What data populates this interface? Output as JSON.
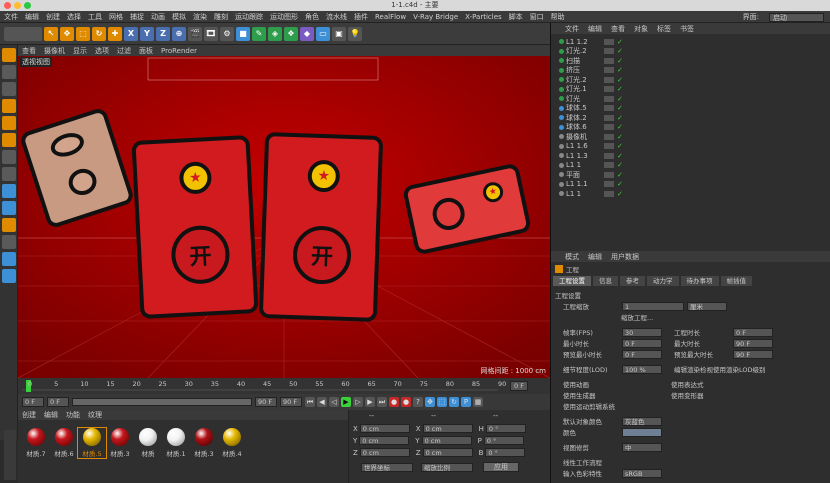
{
  "window": {
    "title": "1-1.c4d - 主要"
  },
  "menubar": [
    "文件",
    "编辑",
    "创建",
    "选择",
    "工具",
    "网格",
    "捕捉",
    "动画",
    "模拟",
    "渲染",
    "雕刻",
    "运动跟踪",
    "运动图形",
    "角色",
    "流水线",
    "插件",
    "RealFlow",
    "V-Ray Bridge",
    "X-Particles",
    "脚本",
    "窗口",
    "帮助"
  ],
  "layout": {
    "label": "界面:",
    "value": "启动"
  },
  "toolbar": {
    "axis_x": "X",
    "axis_y": "Y",
    "axis_z": "Z"
  },
  "viewport": {
    "menu": [
      "查看",
      "摄像机",
      "显示",
      "选项",
      "过滤",
      "面板",
      "ProRender"
    ],
    "label": "透视视图",
    "grid_info": "网格间距 : 1000 cm",
    "glyph": "开"
  },
  "timeline": {
    "ticks": [
      "0",
      "5",
      "10",
      "15",
      "20",
      "25",
      "30",
      "35",
      "40",
      "45",
      "50",
      "55",
      "60",
      "65",
      "70",
      "75",
      "80",
      "85",
      "90"
    ],
    "end": "0 F"
  },
  "transport": {
    "start": "0 F",
    "current": "0 F",
    "end": "90 F",
    "end2": "90 F"
  },
  "materials": {
    "menu": [
      "创建",
      "编辑",
      "功能",
      "纹理"
    ],
    "items": [
      {
        "label": "材质.7",
        "color": "#c4161c"
      },
      {
        "label": "材质.6",
        "color": "#c4161c"
      },
      {
        "label": "材质.5",
        "color": "#e6b800"
      },
      {
        "label": "材质.3",
        "color": "#c4161c"
      },
      {
        "label": "材质",
        "color": "#f2f2f2"
      },
      {
        "label": "材质.1",
        "color": "#f2f2f2"
      },
      {
        "label": "材质.3",
        "color": "#b01015"
      },
      {
        "label": "材质.4",
        "color": "#e6b800"
      }
    ]
  },
  "coords": {
    "header": [
      "--",
      "--",
      "--"
    ],
    "rows": [
      {
        "a": "X",
        "av": "0 cm",
        "b": "X",
        "bv": "0 cm",
        "c": "H",
        "cv": "0 °"
      },
      {
        "a": "Y",
        "av": "0 cm",
        "b": "Y",
        "bv": "0 cm",
        "c": "P",
        "cv": "0 °"
      },
      {
        "a": "Z",
        "av": "0 cm",
        "b": "Z",
        "bv": "0 cm",
        "c": "B",
        "cv": "0 °"
      }
    ],
    "mode1": "世界坐标",
    "mode2": "缩放比例",
    "apply": "应用"
  },
  "objects": {
    "menu": [
      "文件",
      "编辑",
      "查看",
      "对象",
      "标签",
      "书签"
    ],
    "rows": [
      "L1 1.2",
      "灯光.2",
      "扫描",
      "挤压",
      "灯光.2",
      "灯光.1",
      "灯光",
      "球体.5",
      "球体.2",
      "球体.6",
      "摄像机",
      "L1 1.6",
      "L1 1.3",
      "L1 1",
      "平面",
      "L1 1.1",
      "L1 1"
    ]
  },
  "attributes": {
    "menu": [
      "模式",
      "编辑",
      "用户数据"
    ],
    "title": "工程",
    "tabs": [
      "工程设置",
      "信息",
      "参考",
      "动力学",
      "待办事项",
      "帧插值"
    ],
    "section": "工程设置",
    "scale_label": "工程缩放",
    "scale_value": "1",
    "scale_unit": "厘米",
    "scale_button": "缩放工程...",
    "fps_label": "帧率(FPS)",
    "fps_value": "30",
    "duration_label": "工程时长",
    "duration_value": "0 F",
    "min_label": "最小时长",
    "min_value": "0 F",
    "max_label": "最大时长",
    "max_value": "90 F",
    "pmin_label": "预览最小时长",
    "pmin_value": "0 F",
    "pmax_label": "预览最大时长",
    "pmax_value": "90 F",
    "lod_label": "细节程度(LOD)",
    "lod_value": "100 %",
    "lod_render": "编辑渲染检视使用渲染LOD级别",
    "use_anim": "使用动画",
    "use_expr": "使用表达式",
    "use_gen": "使用生成器",
    "use_deform": "使用变形器",
    "use_motion": "使用运动剪辑系统",
    "default_color_label": "默认对象颜色",
    "default_color_value": "灰蓝色",
    "color_label": "颜色",
    "view_clip_label": "视图修剪",
    "view_clip_value": "中",
    "linear_label": "线性工作流程",
    "input_color_label": "输入色彩特性",
    "input_color_value": "sRGB"
  }
}
